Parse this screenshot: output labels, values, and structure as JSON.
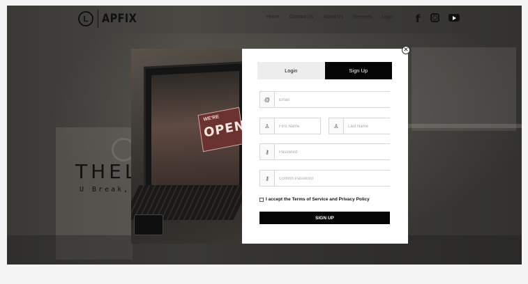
{
  "header": {
    "logo_mark": "L",
    "logo_text": "APFIX",
    "nav": [
      "Home",
      "Contact Us",
      "About Us",
      "Services",
      "Login"
    ]
  },
  "hero": {
    "title": "THEL",
    "subtitle": "U Break, I"
  },
  "modal": {
    "close_glyph": "✕",
    "tabs": {
      "login": "Login",
      "signup": "Sign Up"
    },
    "fields": {
      "email": {
        "placeholder": "Email",
        "icon": "at-icon",
        "glyph": "@"
      },
      "first_name": {
        "placeholder": "First Name",
        "icon": "user-icon",
        "glyph": "♙"
      },
      "last_name": {
        "placeholder": "Last Name",
        "icon": "user-icon",
        "glyph": "♙"
      },
      "password": {
        "placeholder": "Password",
        "icon": "key-icon",
        "glyph": "⚷"
      },
      "confirm_password": {
        "placeholder": "Confirm Password",
        "icon": "key-icon",
        "glyph": "⚷"
      }
    },
    "terms_label": "I accept the Terms of Service and Privacy Policy",
    "submit_label": "SIGN UP",
    "image": {
      "sign_small": "WE'RE",
      "sign_big": "OPEN"
    }
  },
  "colors": {
    "primary": "#050505",
    "tab_inactive": "#ededed",
    "overlay": "#3b3a37"
  }
}
